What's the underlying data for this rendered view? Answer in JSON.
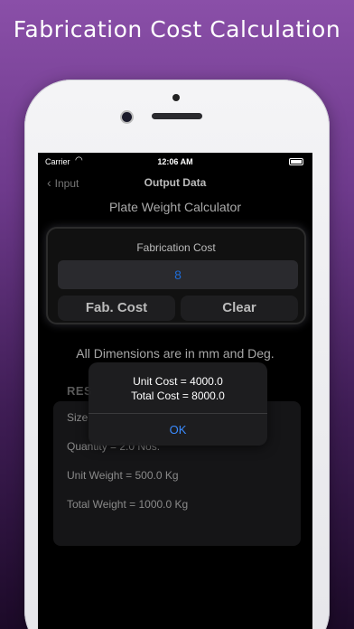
{
  "promo": {
    "title": "Fabrication Cost Calculation"
  },
  "status_bar": {
    "carrier": "Carrier",
    "time": "12:06 AM"
  },
  "nav": {
    "back_label": "Input",
    "title": "Output Data"
  },
  "subtitle": "Plate Weight Calculator",
  "fab_cost": {
    "label": "Fabrication Cost",
    "input_value": "8",
    "calc_button": "Fab. Cost",
    "clear_button": "Clear"
  },
  "dimensions_note": "All Dimensions are in mm and Deg.",
  "result": {
    "heading": "RES",
    "rows": [
      "Size",
      "Quantity = 2.0 Nos.",
      "Unit Weight = 500.0 Kg",
      "Total Weight = 1000.0 Kg"
    ]
  },
  "alert": {
    "line1": "Unit Cost = 4000.0",
    "line2": "Total Cost = 8000.0",
    "ok": "OK"
  },
  "colors": {
    "input_text": "#1e6bd6",
    "alert_ok": "#3a8bff",
    "background_top": "#8a4fa8"
  }
}
